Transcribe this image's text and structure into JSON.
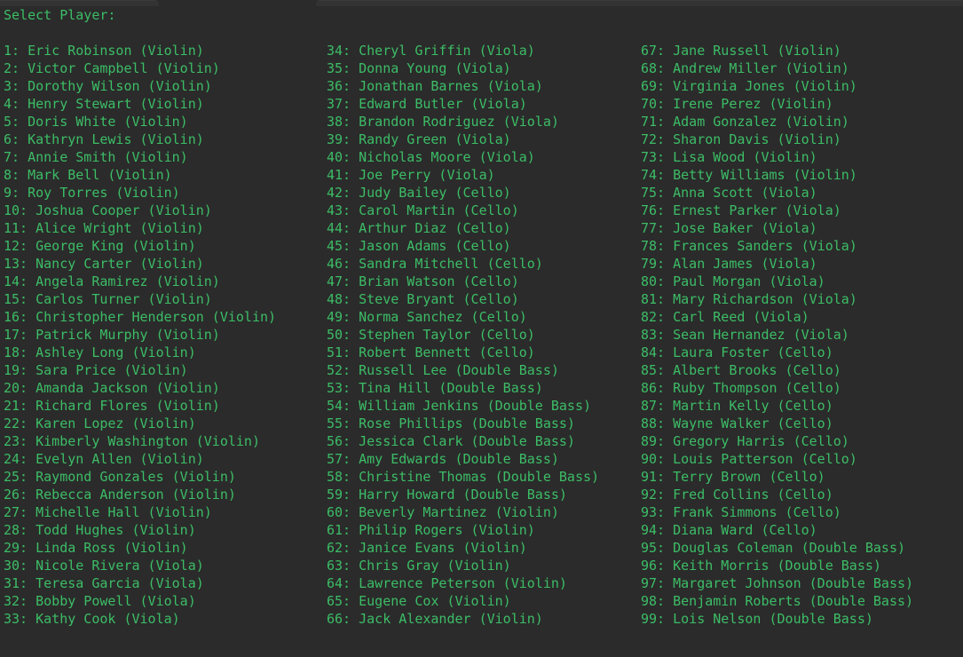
{
  "window": {
    "background_color": "#2b2b2b",
    "text_color": "#3cbd66",
    "tab_color": "#333333",
    "tabs": [
      {
        "name": "tab-stub-left",
        "label": ""
      },
      {
        "name": "tab-stub-right",
        "label": ""
      }
    ]
  },
  "prompt": {
    "label": "Select Player:"
  },
  "players": {
    "column_1": [
      "1: Eric Robinson (Violin)",
      "2: Victor Campbell (Violin)",
      "3: Dorothy Wilson (Violin)",
      "4: Henry Stewart (Violin)",
      "5: Doris White (Violin)",
      "6: Kathryn Lewis (Violin)",
      "7: Annie Smith (Violin)",
      "8: Mark Bell (Violin)",
      "9: Roy Torres (Violin)",
      "10: Joshua Cooper (Violin)",
      "11: Alice Wright (Violin)",
      "12: George King (Violin)",
      "13: Nancy Carter (Violin)",
      "14: Angela Ramirez (Violin)",
      "15: Carlos Turner (Violin)",
      "16: Christopher Henderson (Violin)",
      "17: Patrick Murphy (Violin)",
      "18: Ashley Long (Violin)",
      "19: Sara Price (Violin)",
      "20: Amanda Jackson (Violin)",
      "21: Richard Flores (Violin)",
      "22: Karen Lopez (Violin)",
      "23: Kimberly Washington (Violin)",
      "24: Evelyn Allen (Violin)",
      "25: Raymond Gonzales (Violin)",
      "26: Rebecca Anderson (Violin)",
      "27: Michelle Hall (Violin)",
      "28: Todd Hughes (Violin)",
      "29: Linda Ross (Violin)",
      "30: Nicole Rivera (Viola)",
      "31: Teresa Garcia (Viola)",
      "32: Bobby Powell (Viola)",
      "33: Kathy Cook (Viola)"
    ],
    "column_2": [
      "34: Cheryl Griffin (Viola)",
      "35: Donna Young (Viola)",
      "36: Jonathan Barnes (Viola)",
      "37: Edward Butler (Viola)",
      "38: Brandon Rodriguez (Viola)",
      "39: Randy Green (Viola)",
      "40: Nicholas Moore (Viola)",
      "41: Joe Perry (Viola)",
      "42: Judy Bailey (Cello)",
      "43: Carol Martin (Cello)",
      "44: Arthur Diaz (Cello)",
      "45: Jason Adams (Cello)",
      "46: Sandra Mitchell (Cello)",
      "47: Brian Watson (Cello)",
      "48: Steve Bryant (Cello)",
      "49: Norma Sanchez (Cello)",
      "50: Stephen Taylor (Cello)",
      "51: Robert Bennett (Cello)",
      "52: Russell Lee (Double Bass)",
      "53: Tina Hill (Double Bass)",
      "54: William Jenkins (Double Bass)",
      "55: Rose Phillips (Double Bass)",
      "56: Jessica Clark (Double Bass)",
      "57: Amy Edwards (Double Bass)",
      "58: Christine Thomas (Double Bass)",
      "59: Harry Howard (Double Bass)",
      "60: Beverly Martinez (Violin)",
      "61: Philip Rogers (Violin)",
      "62: Janice Evans (Violin)",
      "63: Chris Gray (Violin)",
      "64: Lawrence Peterson (Violin)",
      "65: Eugene Cox (Violin)",
      "66: Jack Alexander (Violin)"
    ],
    "column_3": [
      "67: Jane Russell (Violin)",
      "68: Andrew Miller (Violin)",
      "69: Virginia Jones (Violin)",
      "70: Irene Perez (Violin)",
      "71: Adam Gonzalez (Violin)",
      "72: Sharon Davis (Violin)",
      "73: Lisa Wood (Violin)",
      "74: Betty Williams (Violin)",
      "75: Anna Scott (Viola)",
      "76: Ernest Parker (Viola)",
      "77: Jose Baker (Viola)",
      "78: Frances Sanders (Viola)",
      "79: Alan James (Viola)",
      "80: Paul Morgan (Viola)",
      "81: Mary Richardson (Viola)",
      "82: Carl Reed (Viola)",
      "83: Sean Hernandez (Viola)",
      "84: Laura Foster (Cello)",
      "85: Albert Brooks (Cello)",
      "86: Ruby Thompson (Cello)",
      "87: Martin Kelly (Cello)",
      "88: Wayne Walker (Cello)",
      "89: Gregory Harris (Cello)",
      "90: Louis Patterson (Cello)",
      "91: Terry Brown (Cello)",
      "92: Fred Collins (Cello)",
      "93: Frank Simmons (Cello)",
      "94: Diana Ward (Cello)",
      "95: Douglas Coleman (Double Bass)",
      "96: Keith Morris (Double Bass)",
      "97: Margaret Johnson (Double Bass)",
      "98: Benjamin Roberts (Double Bass)",
      "99: Lois Nelson (Double Bass)"
    ]
  }
}
